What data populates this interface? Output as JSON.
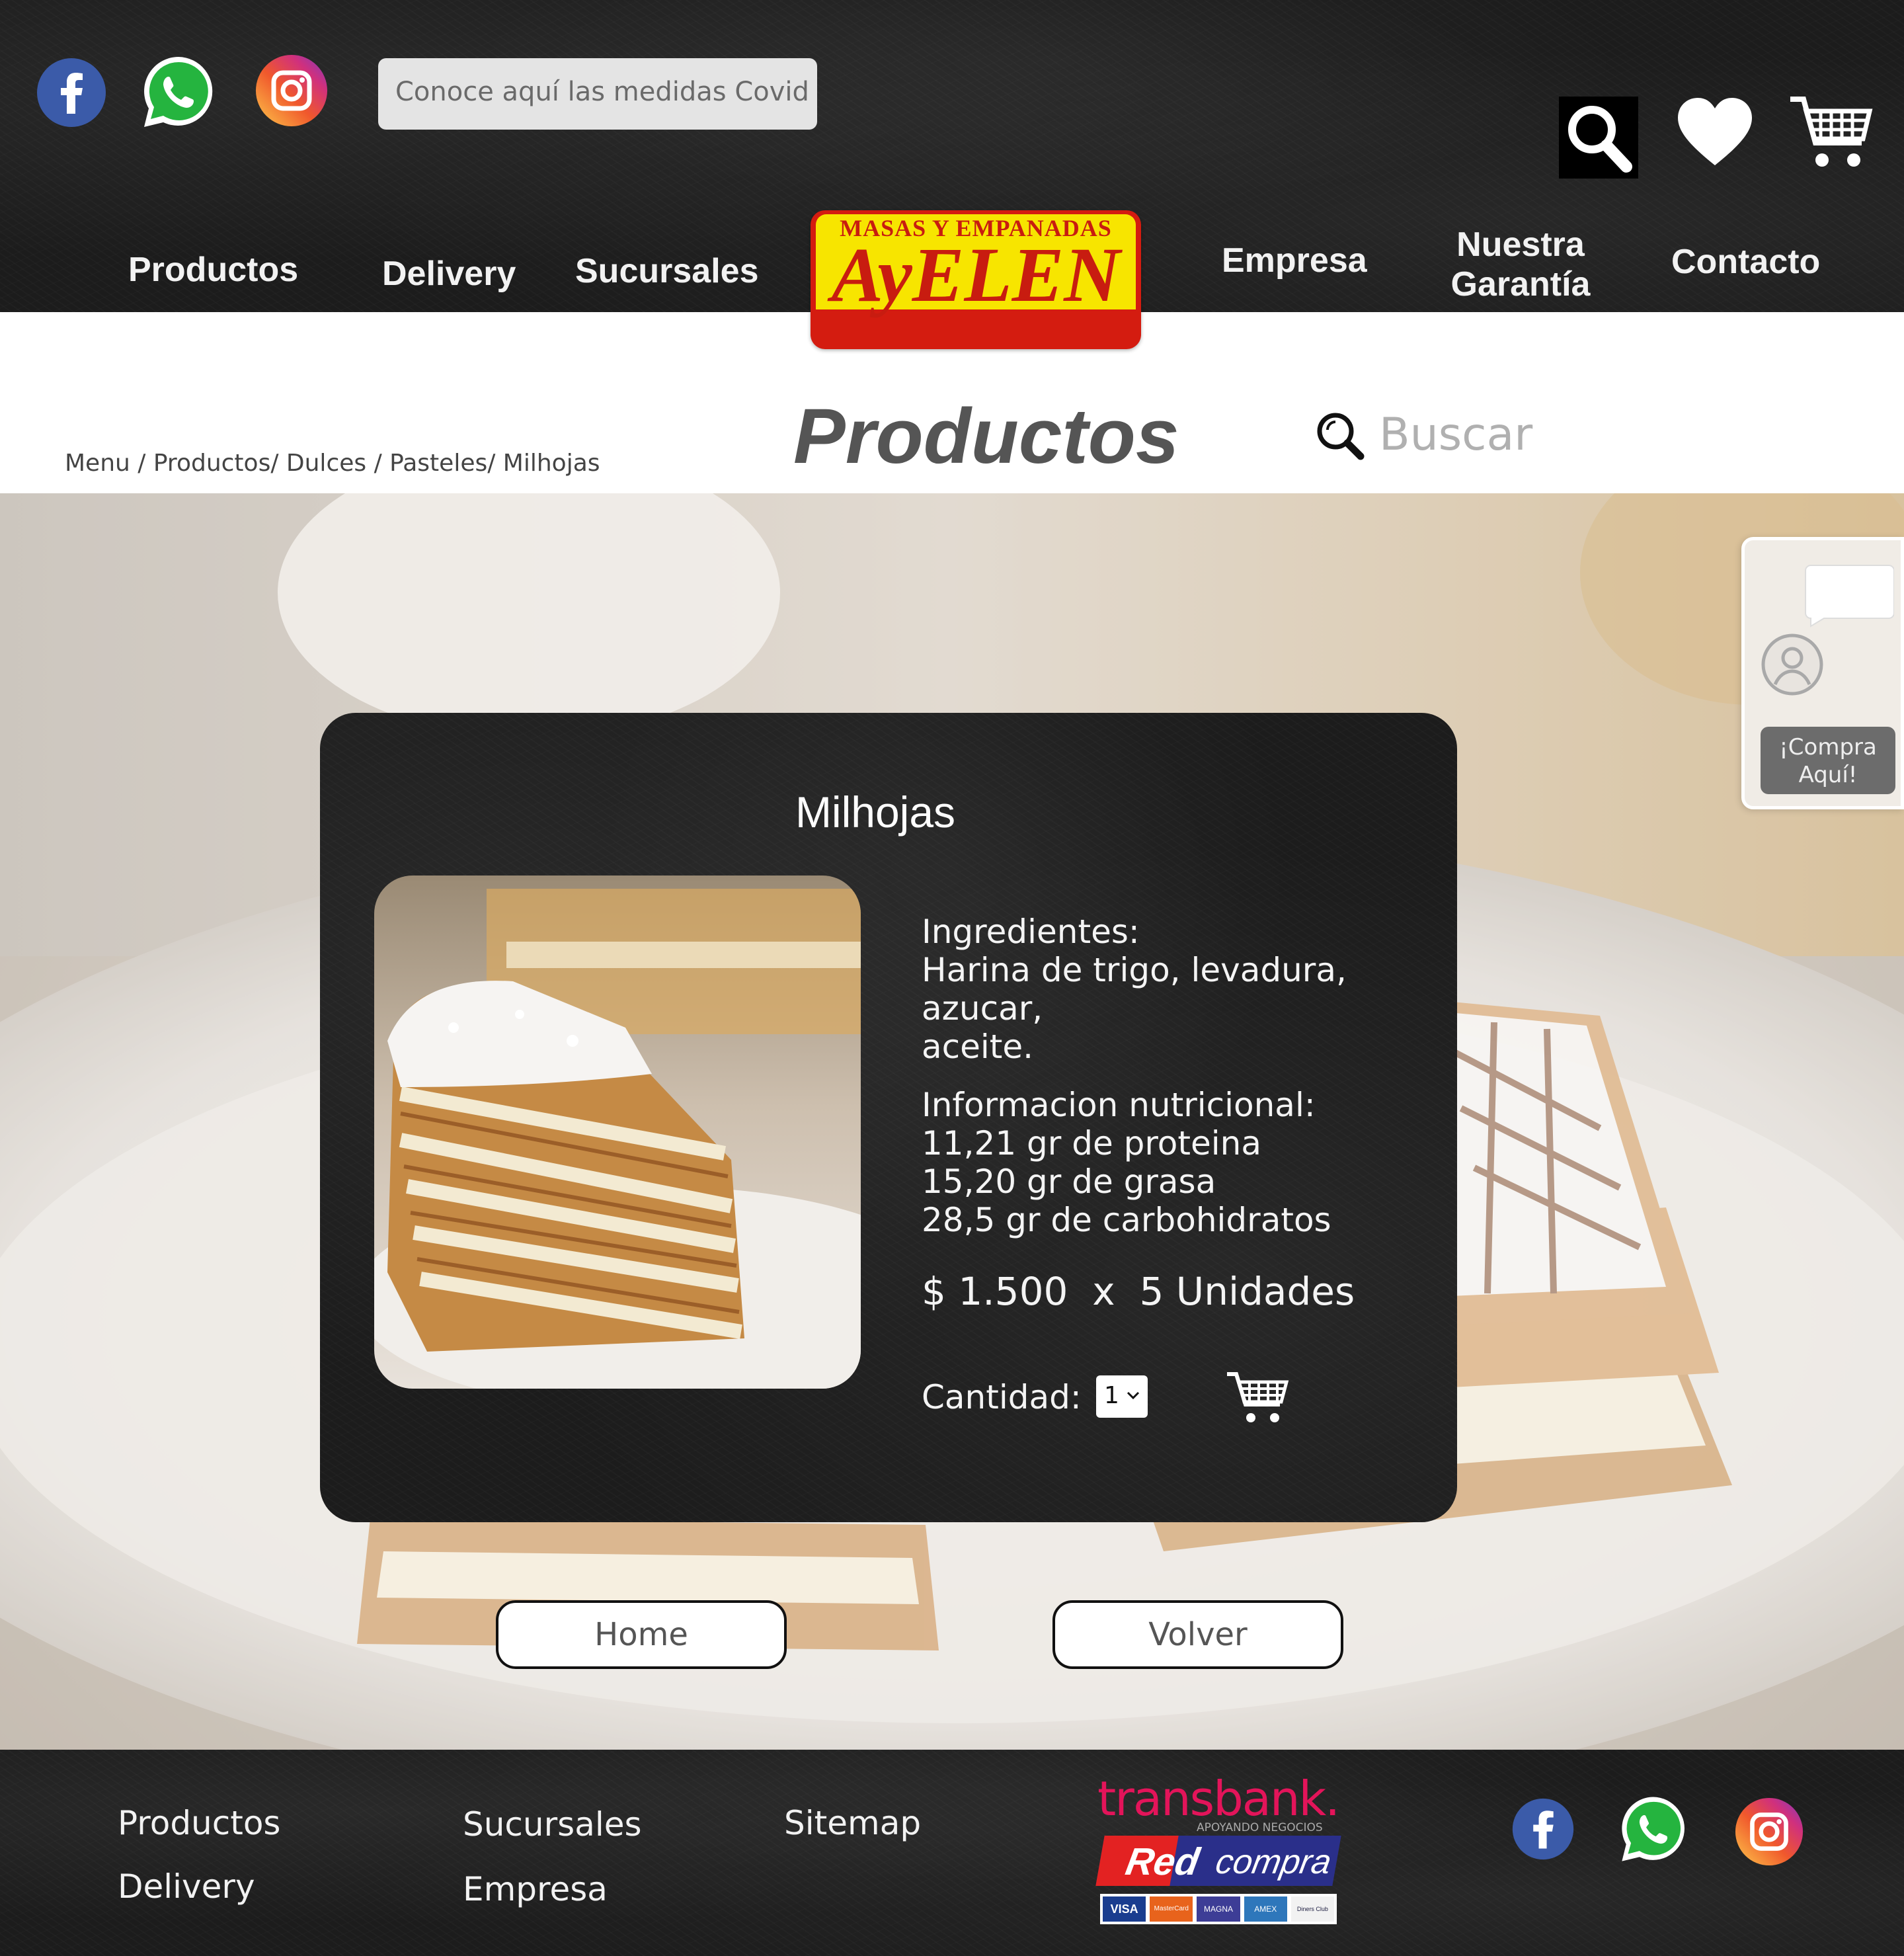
{
  "header": {
    "covid_notice": "Conoce aquí las medidas Covid",
    "nav": {
      "productos": "Productos",
      "delivery": "Delivery",
      "sucursales": "Sucursales",
      "empresa": "Empresa",
      "garantia_line1": "Nuestra",
      "garantia_line2": "Garantía",
      "contacto": "Contacto"
    },
    "icons": [
      "facebook-icon",
      "whatsapp-icon",
      "instagram-icon",
      "search-icon",
      "heart-icon",
      "cart-icon"
    ]
  },
  "logo": {
    "tagline": "MASAS Y EMPANADAS",
    "brand": "AyELEN",
    "colors": {
      "red": "#d41c10",
      "yellow": "#f7e500"
    }
  },
  "title_bar": {
    "breadcrumb": "Menu / Productos/  Dulces / Pasteles/ Milhojas",
    "page_title": "Productos",
    "search_placeholder": "Buscar"
  },
  "product": {
    "name": "Milhojas",
    "ingredients_label": "Ingredientes:",
    "ingredients_line1": "Harina de trigo, levadura, azucar,",
    "ingredients_line2": "aceite.",
    "nutrition_label": "Informacion nutricional:",
    "nutrition": [
      "11,21 gr de proteina",
      "15,20 gr de grasa",
      "28,5 gr de carbohidratos"
    ],
    "price": "$ 1.500  x  5 Unidades",
    "quantity_label": "Cantidad:",
    "quantity_value": "1"
  },
  "buttons": {
    "home": "Home",
    "volver": "Volver"
  },
  "chat": {
    "cta_line1": "¡Compra",
    "cta_line2": "Aquí!"
  },
  "footer": {
    "links": {
      "productos": "Productos",
      "delivery": "Delivery",
      "sucursales": "Sucursales",
      "empresa": "Empresa",
      "sitemap": "Sitemap"
    },
    "payment": {
      "transbank": "transbank.",
      "transbank_sub": "APOYANDO NEGOCIOS",
      "redcompra_red": "Red",
      "redcompra_compra": "compra",
      "cards": [
        "VISA",
        "MasterCard",
        "MAGNA",
        "AMEX",
        "Diners Club"
      ]
    }
  }
}
